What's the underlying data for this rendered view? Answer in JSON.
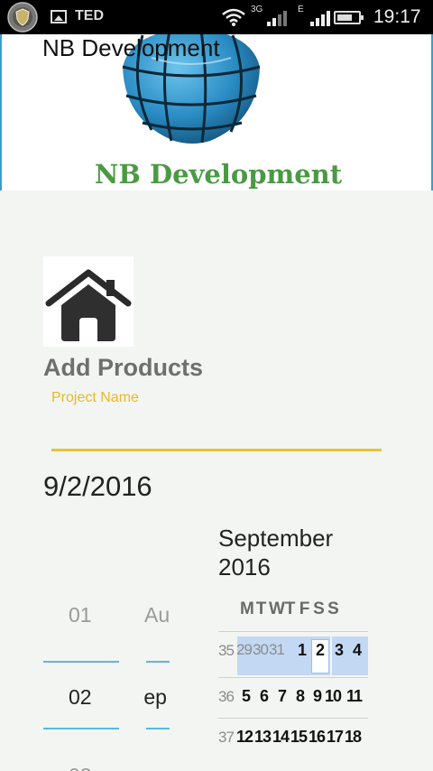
{
  "status_bar": {
    "carrier_label": "TED",
    "network_3g": "3G",
    "network_e": "E",
    "time": "19:17"
  },
  "banner": {
    "title": "NB Development",
    "logo_text": "NB Development",
    "brand_color": "#4a9a44",
    "globe_color": "#2a8cc4"
  },
  "form": {
    "heading": "Add Products",
    "project_name_label": "Project Name",
    "project_name_value": "",
    "accent_color": "#e8c23a"
  },
  "date_picker": {
    "selected_date": "9/2/2016",
    "spinner": {
      "day_prev": "01",
      "day_current": "02",
      "month_prev": "Aug",
      "month_current": "Sep"
    },
    "calendar": {
      "month_title": "September 2016",
      "weekday_headers": [
        "M",
        "T",
        "W",
        "T",
        "F",
        "S",
        "S"
      ],
      "weeks": [
        {
          "week_no": "35",
          "days": [
            "29",
            "30",
            "31",
            "1",
            "2",
            "3",
            "4"
          ]
        },
        {
          "week_no": "36",
          "days": [
            "5",
            "6",
            "7",
            "8",
            "9",
            "10",
            "11"
          ]
        },
        {
          "week_no": "37",
          "days": [
            "12",
            "13",
            "14",
            "15",
            "16",
            "17",
            "18"
          ]
        }
      ],
      "highlight_color": "#c3d8f3"
    }
  }
}
